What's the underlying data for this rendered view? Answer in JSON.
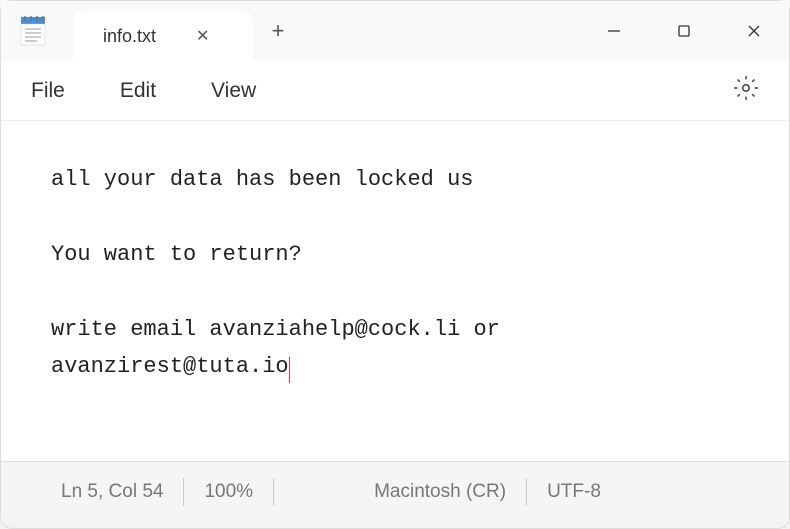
{
  "tab": {
    "title": "info.txt"
  },
  "menu": {
    "file": "File",
    "edit": "Edit",
    "view": "View"
  },
  "content": {
    "line1": "all your data has been locked us",
    "line2": "You want to return?",
    "line3a": "write email avanziahelp@cock.li or",
    "line3b": "avanzirest@tuta.io"
  },
  "statusbar": {
    "position": "Ln 5, Col 54",
    "zoom": "100%",
    "line_ending": "Macintosh (CR)",
    "encoding": "UTF-8"
  }
}
